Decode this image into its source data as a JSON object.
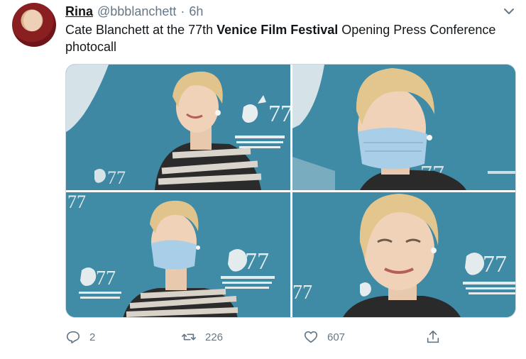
{
  "tweet": {
    "author_name": "Rina",
    "author_handle": "@bbblanchett",
    "separator": "·",
    "time": "6h",
    "text_before": "Cate Blanchett at the 77th ",
    "text_bold": "Venice Film Festival",
    "text_after": " Opening Press Conference photocall",
    "photos": [
      {
        "pose": "profile-smiling"
      },
      {
        "pose": "masked-closeup"
      },
      {
        "pose": "masked-full"
      },
      {
        "pose": "closeup-smiling"
      }
    ],
    "counts": {
      "replies": "2",
      "retweets": "226",
      "likes": "607"
    }
  },
  "icons": {
    "caret": "chevron-down-icon",
    "reply": "reply-icon",
    "retweet": "retweet-icon",
    "like": "heart-icon",
    "share": "share-icon"
  },
  "colors": {
    "text_primary": "#14171a",
    "text_secondary": "#657786",
    "backdrop_teal": "#3f8aa5",
    "mask_blue": "#a9cfe8"
  }
}
